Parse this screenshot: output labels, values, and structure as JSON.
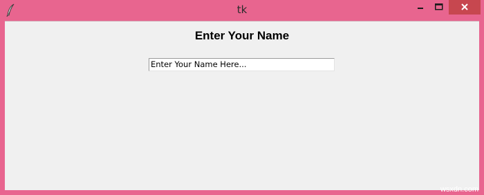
{
  "window": {
    "title": "tk",
    "icon": "feather-icon",
    "frame_color": "#e8658f",
    "close_color": "#c7474f",
    "controls": {
      "minimize": "minimize-icon",
      "maximize": "maximize-icon",
      "close": "close-icon"
    }
  },
  "main": {
    "heading": "Enter Your Name",
    "name_entry": {
      "value": "Enter Your Name Here..."
    }
  },
  "watermark": "wsxdn.com"
}
